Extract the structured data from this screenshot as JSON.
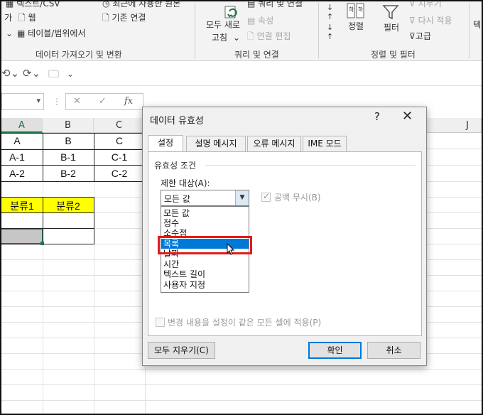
{
  "ribbon": {
    "get_data": {
      "csv_label": "텍스트/CSV",
      "web_label": "웹",
      "table_label": "테이블/범위에서",
      "ga_label": "가",
      "recent_label": "최근에 사용한 원본",
      "existing_label": "기존 연결",
      "group_label": "데이터 가져오기 및 변환"
    },
    "queries": {
      "refresh_label_1": "모두 새로",
      "refresh_label_2": "고침",
      "queries_label": "쿼리 및 연결",
      "properties_label": "속성",
      "edit_links_label": "연결 편집",
      "group_label": "쿼리 및 연결"
    },
    "sort_filter": {
      "sort_label": "정렬",
      "filter_label": "필터",
      "clear_label": "지우기",
      "reapply_label": "다시 적용",
      "advanced_label": "고급",
      "sort_az": "하\n하",
      "group_label": "정렬 및 필터"
    },
    "extra_label": "텍"
  },
  "formula_bar": {
    "name_box": "",
    "fx": "fx",
    "cancel": "✕",
    "enter": "✓"
  },
  "sheet": {
    "columns": [
      "A",
      "B",
      "C",
      "J"
    ],
    "rows": [
      [
        "A",
        "B",
        "C"
      ],
      [
        "A-1",
        "B-1",
        "C-1"
      ],
      [
        "A-2",
        "B-2",
        "C-2"
      ]
    ],
    "headers2": [
      "분류1",
      "분류2"
    ],
    "header_fill": "#ffff00"
  },
  "dialog": {
    "title": "데이터 유효성",
    "help": "?",
    "close": "✕",
    "tabs": [
      "설정",
      "설명 메시지",
      "오류 메시지",
      "IME 모드"
    ],
    "section_title": "유효성 조건",
    "allow_label": "제한 대상(A):",
    "allow_value": "모든 값",
    "ignore_blank_label": "공백 무시(B)",
    "options": [
      "모든 값",
      "정수",
      "소수점",
      "목록",
      "날짜",
      "시간",
      "텍스트 길이",
      "사용자 지정"
    ],
    "selected_option": "목록",
    "apply_all_label": "변경 내용을 설정이 같은 모든 셀에 적용(P)",
    "clear_all_label": "모두 지우기(C)",
    "ok_label": "확인",
    "cancel_label": "취소"
  },
  "colors": {
    "selection": "#0078d7",
    "highlight_box": "#e31b1b",
    "excel_green": "#217346"
  }
}
